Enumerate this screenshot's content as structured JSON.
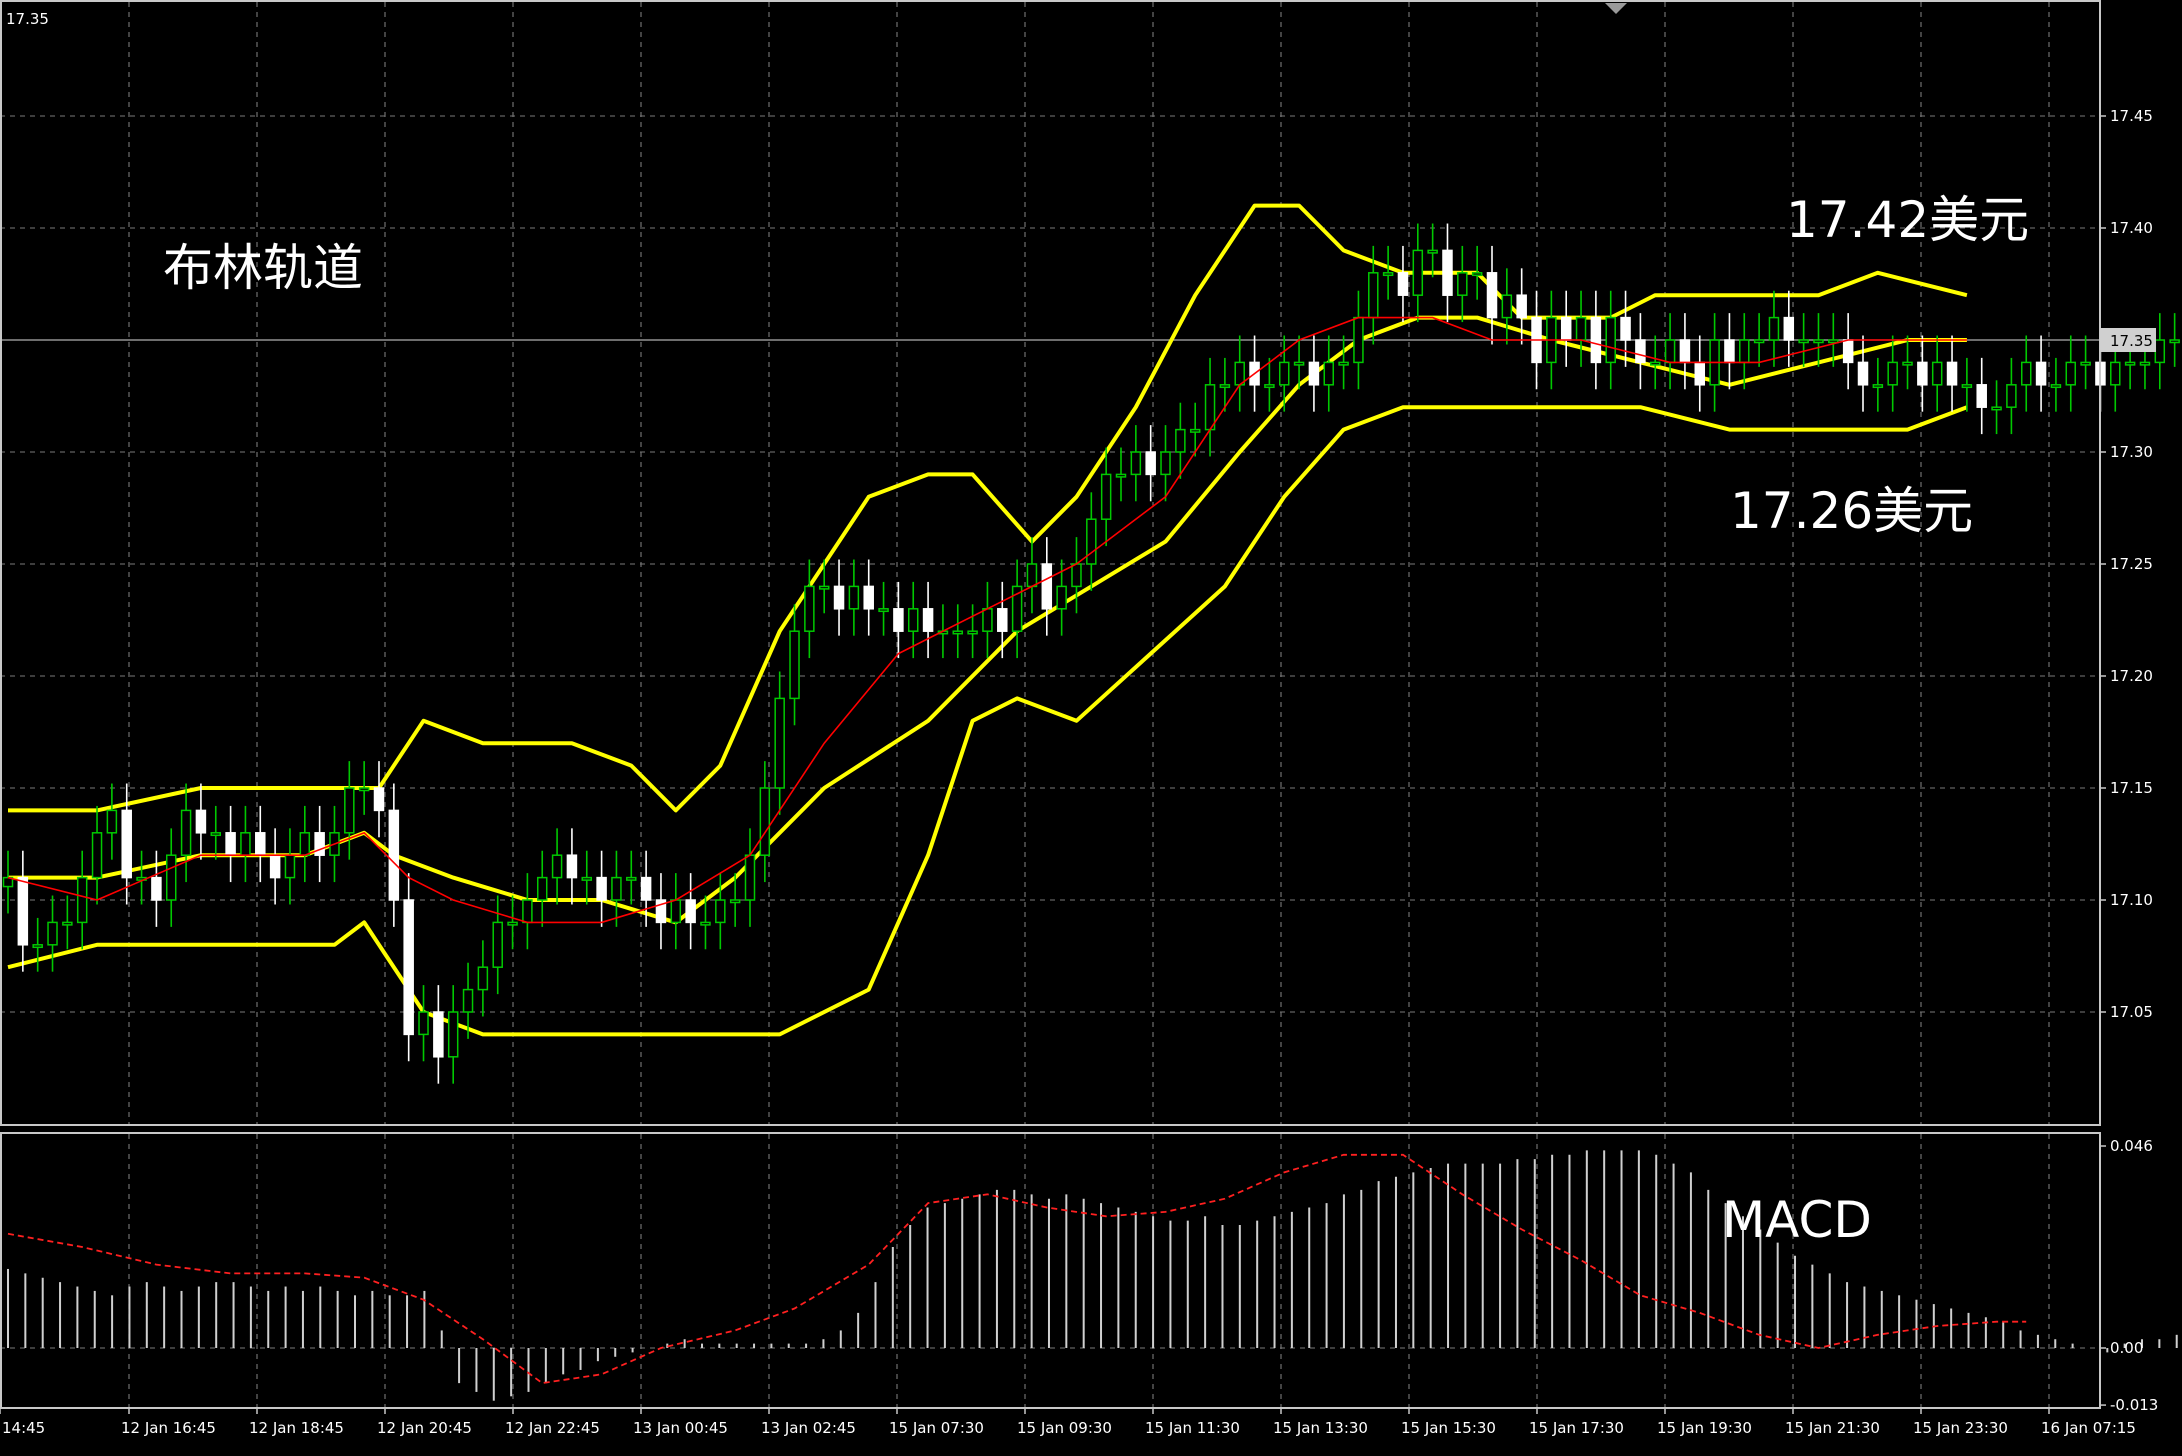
{
  "corner_price": "17.35",
  "annotations": {
    "title": "布林轨道",
    "upper_label": "17.42美元",
    "lower_label": "17.26美元",
    "macd_label": "MACD"
  },
  "current_price": {
    "value": 17.35,
    "label": "17.35"
  },
  "colors": {
    "background": "#000000",
    "grid": "#7a7a7a",
    "frame": "#c8c8c8",
    "bull_candle": "#00c800",
    "bull_body_fill": "#000000",
    "bear_candle": "#ffffff",
    "bollinger": "#ffff00",
    "moving_average": "#ff0000",
    "macd_histogram": "#d0d0d0",
    "macd_signal": "#ff2020"
  },
  "chart_data": [
    {
      "type": "candlestick",
      "title": "布林轨道",
      "ylim": [
        17.0,
        17.5
      ],
      "y_ticks": [
        "17.45",
        "17.40",
        "17.35",
        "17.30",
        "17.25",
        "17.20",
        "17.15",
        "17.10",
        "17.05"
      ],
      "x_ticks": [
        "14:45",
        "12 Jan 16:45",
        "12 Jan 18:45",
        "12 Jan 20:45",
        "12 Jan 22:45",
        "13 Jan 00:45",
        "13 Jan 02:45",
        "15 Jan 07:30",
        "15 Jan 09:30",
        "15 Jan 11:30",
        "15 Jan 13:30",
        "15 Jan 15:30",
        "15 Jan 17:30",
        "15 Jan 19:30",
        "15 Jan 21:30",
        "15 Jan 23:30",
        "16 Jan 07:15"
      ],
      "price_anchor": [
        17.11,
        17.08,
        17.08,
        17.09,
        17.09,
        17.11,
        17.13,
        17.14,
        17.11,
        17.11,
        17.1,
        17.12,
        17.14,
        17.13,
        17.13,
        17.12,
        17.13,
        17.12,
        17.11,
        17.12,
        17.13,
        17.12,
        17.13,
        17.15,
        17.15,
        17.14,
        17.1,
        17.04,
        17.05,
        17.03,
        17.05,
        17.06,
        17.07,
        17.09,
        17.09,
        17.1,
        17.11,
        17.12,
        17.11,
        17.11,
        17.1,
        17.11,
        17.11,
        17.1,
        17.09,
        17.1,
        17.09,
        17.09,
        17.1,
        17.1,
        17.12,
        17.15,
        17.19,
        17.22,
        17.24,
        17.24,
        17.23,
        17.24,
        17.23,
        17.23,
        17.22,
        17.23,
        17.22,
        17.22,
        17.22,
        17.22,
        17.23,
        17.22,
        17.24,
        17.25,
        17.23,
        17.24,
        17.25,
        17.27,
        17.29,
        17.29,
        17.3,
        17.29,
        17.3,
        17.31,
        17.31,
        17.33,
        17.33,
        17.34,
        17.33,
        17.33,
        17.34,
        17.34,
        17.33,
        17.34,
        17.34,
        17.36,
        17.38,
        17.38,
        17.37,
        17.39,
        17.39,
        17.37,
        17.38,
        17.38,
        17.36,
        17.37,
        17.36,
        17.34,
        17.36,
        17.35,
        17.36,
        17.34,
        17.36,
        17.35,
        17.34,
        17.34,
        17.35,
        17.34,
        17.33,
        17.35,
        17.34,
        17.35,
        17.35,
        17.36,
        17.35,
        17.35,
        17.35,
        17.35,
        17.34,
        17.33,
        17.33,
        17.34,
        17.34,
        17.33,
        17.34,
        17.33,
        17.33,
        17.32,
        17.32,
        17.33,
        17.34,
        17.33,
        17.33,
        17.34,
        17.34,
        17.33,
        17.34,
        17.34,
        17.34,
        17.35,
        17.35,
        17.34,
        17.34,
        17.34,
        17.35,
        17.36,
        17.35,
        17.36,
        17.35,
        17.35,
        17.34,
        17.34,
        17.33,
        17.35
      ],
      "bollinger_upper": [
        [
          0,
          17.14
        ],
        [
          6,
          17.14
        ],
        [
          13,
          17.15
        ],
        [
          22,
          17.15
        ],
        [
          25,
          17.15
        ],
        [
          28,
          17.18
        ],
        [
          32,
          17.17
        ],
        [
          38,
          17.17
        ],
        [
          42,
          17.16
        ],
        [
          45,
          17.14
        ],
        [
          48,
          17.16
        ],
        [
          52,
          17.22
        ],
        [
          58,
          17.28
        ],
        [
          62,
          17.29
        ],
        [
          65,
          17.29
        ],
        [
          69,
          17.26
        ],
        [
          72,
          17.28
        ],
        [
          76,
          17.32
        ],
        [
          80,
          17.37
        ],
        [
          84,
          17.41
        ],
        [
          87,
          17.41
        ],
        [
          90,
          17.39
        ],
        [
          94,
          17.38
        ],
        [
          99,
          17.38
        ],
        [
          102,
          17.36
        ],
        [
          108,
          17.36
        ],
        [
          111,
          17.37
        ],
        [
          115,
          17.37
        ],
        [
          122,
          17.37
        ],
        [
          126,
          17.38
        ],
        [
          132,
          17.37
        ]
      ],
      "bollinger_middle": [
        [
          0,
          17.11
        ],
        [
          6,
          17.11
        ],
        [
          13,
          17.12
        ],
        [
          20,
          17.12
        ],
        [
          24,
          17.13
        ],
        [
          26,
          17.12
        ],
        [
          30,
          17.11
        ],
        [
          35,
          17.1
        ],
        [
          40,
          17.1
        ],
        [
          45,
          17.09
        ],
        [
          49,
          17.11
        ],
        [
          55,
          17.15
        ],
        [
          62,
          17.18
        ],
        [
          68,
          17.22
        ],
        [
          73,
          17.24
        ],
        [
          78,
          17.26
        ],
        [
          83,
          17.3
        ],
        [
          87,
          17.33
        ],
        [
          91,
          17.35
        ],
        [
          95,
          17.36
        ],
        [
          99,
          17.36
        ],
        [
          104,
          17.35
        ],
        [
          110,
          17.34
        ],
        [
          116,
          17.33
        ],
        [
          122,
          17.34
        ],
        [
          128,
          17.35
        ],
        [
          132,
          17.35
        ]
      ],
      "bollinger_lower": [
        [
          0,
          17.07
        ],
        [
          6,
          17.08
        ],
        [
          13,
          17.08
        ],
        [
          22,
          17.08
        ],
        [
          24,
          17.09
        ],
        [
          25,
          17.08
        ],
        [
          28,
          17.05
        ],
        [
          32,
          17.04
        ],
        [
          38,
          17.04
        ],
        [
          42,
          17.04
        ],
        [
          45,
          17.04
        ],
        [
          48,
          17.04
        ],
        [
          52,
          17.04
        ],
        [
          58,
          17.06
        ],
        [
          62,
          17.12
        ],
        [
          65,
          17.18
        ],
        [
          68,
          17.19
        ],
        [
          72,
          17.18
        ],
        [
          77,
          17.21
        ],
        [
          82,
          17.24
        ],
        [
          86,
          17.28
        ],
        [
          90,
          17.31
        ],
        [
          94,
          17.32
        ],
        [
          100,
          17.32
        ],
        [
          105,
          17.32
        ],
        [
          110,
          17.32
        ],
        [
          116,
          17.31
        ],
        [
          122,
          17.31
        ],
        [
          128,
          17.31
        ],
        [
          132,
          17.32
        ]
      ],
      "moving_average": [
        [
          0,
          17.11
        ],
        [
          6,
          17.1
        ],
        [
          13,
          17.12
        ],
        [
          20,
          17.12
        ],
        [
          24,
          17.13
        ],
        [
          27,
          17.11
        ],
        [
          30,
          17.1
        ],
        [
          35,
          17.09
        ],
        [
          40,
          17.09
        ],
        [
          45,
          17.1
        ],
        [
          50,
          17.12
        ],
        [
          55,
          17.17
        ],
        [
          60,
          17.21
        ],
        [
          66,
          17.23
        ],
        [
          72,
          17.25
        ],
        [
          78,
          17.28
        ],
        [
          83,
          17.33
        ],
        [
          87,
          17.35
        ],
        [
          91,
          17.36
        ],
        [
          96,
          17.36
        ],
        [
          100,
          17.35
        ],
        [
          106,
          17.35
        ],
        [
          112,
          17.34
        ],
        [
          118,
          17.34
        ],
        [
          124,
          17.35
        ],
        [
          128,
          17.35
        ],
        [
          132,
          17.35
        ]
      ]
    },
    {
      "type": "bar",
      "title": "MACD",
      "ylim": [
        -0.013,
        0.046
      ],
      "y_ticks": [
        "0.046",
        "0.00",
        "-0.013"
      ],
      "histogram": [
        0.018,
        0.017,
        0.016,
        0.015,
        0.014,
        0.013,
        0.012,
        0.014,
        0.015,
        0.014,
        0.013,
        0.014,
        0.015,
        0.015,
        0.014,
        0.013,
        0.014,
        0.013,
        0.014,
        0.013,
        0.012,
        0.013,
        0.012,
        0.012,
        0.013,
        0.004,
        -0.008,
        -0.01,
        -0.012,
        -0.011,
        -0.01,
        -0.008,
        -0.006,
        -0.005,
        -0.003,
        -0.002,
        -0.001,
        0.0,
        0.001,
        0.002,
        0.001,
        0.001,
        0.001,
        0.001,
        0.001,
        0.001,
        0.001,
        0.002,
        0.004,
        0.008,
        0.015,
        0.023,
        0.028,
        0.032,
        0.033,
        0.034,
        0.035,
        0.036,
        0.036,
        0.035,
        0.034,
        0.035,
        0.034,
        0.033,
        0.032,
        0.031,
        0.03,
        0.029,
        0.029,
        0.03,
        0.028,
        0.028,
        0.029,
        0.03,
        0.031,
        0.032,
        0.033,
        0.035,
        0.036,
        0.038,
        0.039,
        0.04,
        0.041,
        0.042,
        0.042,
        0.042,
        0.042,
        0.043,
        0.043,
        0.044,
        0.044,
        0.045,
        0.045,
        0.045,
        0.045,
        0.044,
        0.042,
        0.04,
        0.036,
        0.033,
        0.03,
        0.027,
        0.024,
        0.021,
        0.019,
        0.017,
        0.015,
        0.014,
        0.013,
        0.012,
        0.011,
        0.01,
        0.009,
        0.008,
        0.007,
        0.006,
        0.004,
        0.003,
        0.002,
        0.001,
        0.0,
        -0.001,
        0.001,
        0.002,
        0.002,
        0.003,
        0.002,
        0.003,
        0.004,
        0.005,
        0.007,
        0.007,
        0.006,
        0.006,
        0.006,
        0.005,
        0.005
      ],
      "signal": [
        [
          0,
          0.026
        ],
        [
          5,
          0.023
        ],
        [
          10,
          0.019
        ],
        [
          15,
          0.017
        ],
        [
          20,
          0.017
        ],
        [
          24,
          0.016
        ],
        [
          28,
          0.011
        ],
        [
          32,
          0.002
        ],
        [
          36,
          -0.008
        ],
        [
          40,
          -0.006
        ],
        [
          44,
          0.0
        ],
        [
          49,
          0.004
        ],
        [
          53,
          0.009
        ],
        [
          58,
          0.019
        ],
        [
          62,
          0.033
        ],
        [
          66,
          0.035
        ],
        [
          70,
          0.032
        ],
        [
          74,
          0.03
        ],
        [
          78,
          0.031
        ],
        [
          82,
          0.034
        ],
        [
          86,
          0.04
        ],
        [
          90,
          0.044
        ],
        [
          94,
          0.044
        ],
        [
          98,
          0.035
        ],
        [
          102,
          0.027
        ],
        [
          106,
          0.02
        ],
        [
          110,
          0.012
        ],
        [
          114,
          0.008
        ],
        [
          118,
          0.003
        ],
        [
          122,
          0.0
        ],
        [
          126,
          0.003
        ],
        [
          130,
          0.005
        ],
        [
          134,
          0.006
        ],
        [
          136,
          0.006
        ]
      ]
    }
  ]
}
